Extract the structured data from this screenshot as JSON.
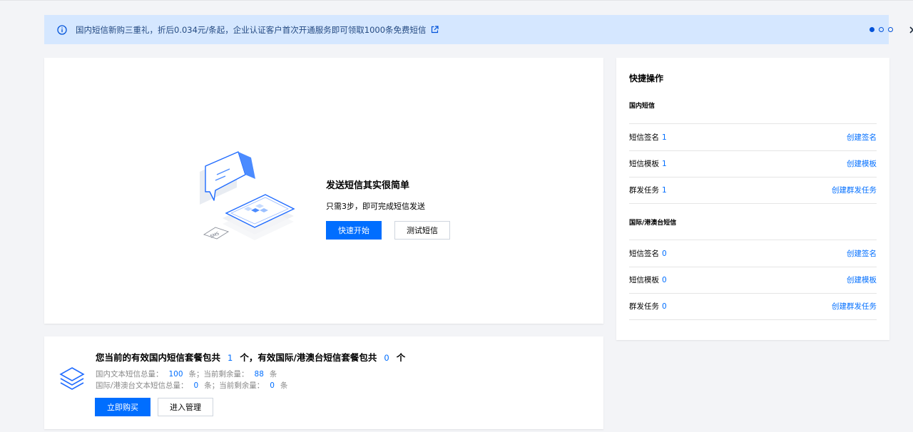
{
  "banner": {
    "message": "国内短信新购三重礼，折后0.034元/条起，企业认证客户首次开通服务即可领取1000条免费短信",
    "info_icon": "info-circle-icon",
    "external_icon": "external-link-icon",
    "close_icon": "close-icon",
    "carousel_pages": 3,
    "carousel_active": 0
  },
  "intro": {
    "title": "发送短信其实很简单",
    "subtitle": "只需3步，即可完成短信发送",
    "start_button": "快速开始",
    "test_button": "测试短信",
    "illustration_badge": "SMS"
  },
  "package": {
    "title_prefix": "您当前的有效国内短信套餐包共",
    "domestic_count": "1",
    "title_middle": "个，有效国际/港澳台短信套餐包共",
    "intl_count": "0",
    "title_suffix": "个",
    "domestic_total_label": "国内文本短信总量：",
    "domestic_total": "100",
    "domestic_unit1": "条；当前剩余量：",
    "domestic_remaining": "88",
    "domestic_unit2": "条",
    "intl_total_label": "国际/港澳台文本短信总量：",
    "intl_total": "0",
    "intl_unit1": "条；当前剩余量：",
    "intl_remaining": "0",
    "intl_unit2": "条",
    "buy_button": "立即购买",
    "manage_button": "进入管理"
  },
  "quick_actions": {
    "title": "快捷操作",
    "domestic": {
      "title": "国内短信",
      "rows": [
        {
          "label": "短信签名",
          "count": "1",
          "action": "创建签名"
        },
        {
          "label": "短信模板",
          "count": "1",
          "action": "创建模板"
        },
        {
          "label": "群发任务",
          "count": "1",
          "action": "创建群发任务"
        }
      ]
    },
    "international": {
      "title": "国际/港澳台短信",
      "rows": [
        {
          "label": "短信签名",
          "count": "0",
          "action": "创建签名"
        },
        {
          "label": "短信模板",
          "count": "0",
          "action": "创建模板"
        },
        {
          "label": "群发任务",
          "count": "0",
          "action": "创建群发任务"
        }
      ]
    }
  },
  "colors": {
    "accent": "#006eff",
    "banner_bg": "#d5e7ff",
    "page_bg": "#f3f4f7"
  }
}
